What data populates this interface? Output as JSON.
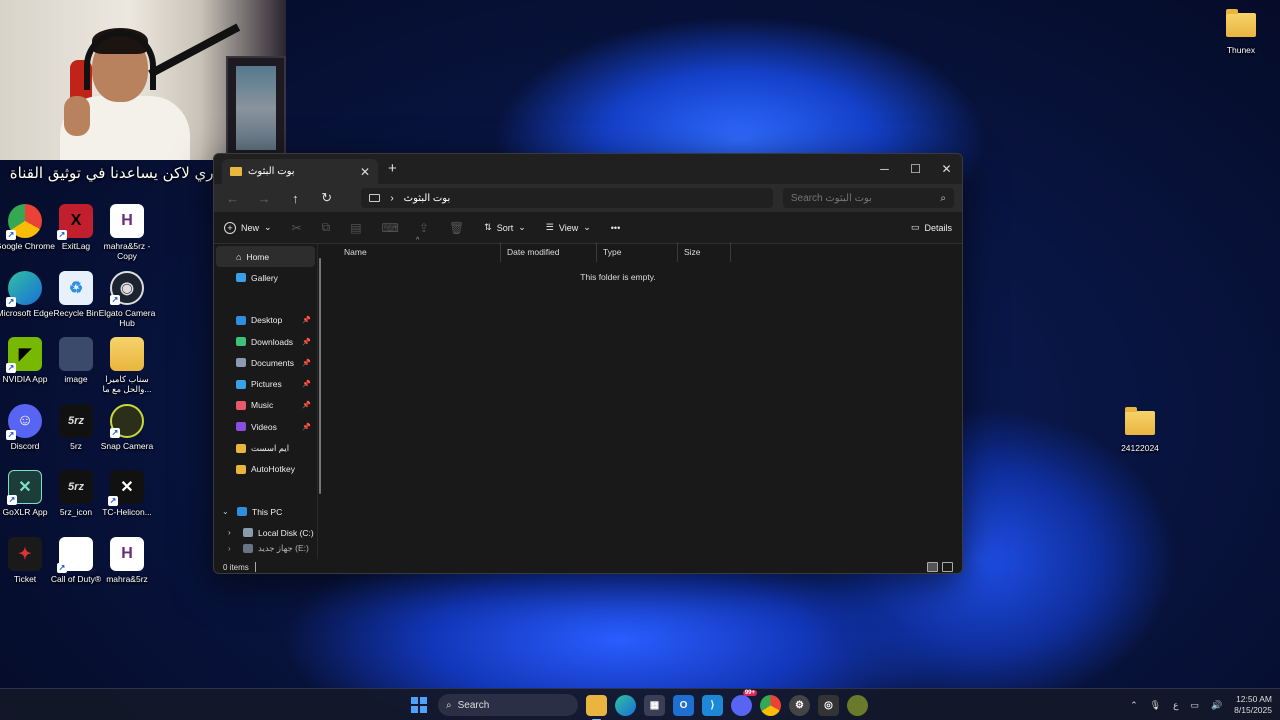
{
  "caption": "الاشتراك مو اجباري لاكن يساعدنا في توثيق القناة",
  "desktop_icons_left": [
    {
      "label": "Google Chrome",
      "icon": "chrome-icon"
    },
    {
      "label": "ExitLag",
      "icon": "exitlag-icon"
    },
    {
      "label": "mahra&5rz - Copy",
      "icon": "document-h-icon"
    },
    {
      "label": "Microsoft Edge",
      "icon": "edge-icon"
    },
    {
      "label": "Recycle Bin",
      "icon": "recycle-bin-icon"
    },
    {
      "label": "Elgato Camera Hub",
      "icon": "camera-hub-icon"
    },
    {
      "label": "NVIDIA App",
      "icon": "nvidia-icon"
    },
    {
      "label": "image",
      "icon": "image-file-icon"
    },
    {
      "label": "سناب كاميرا والحل مع ما...",
      "icon": "folder-icon"
    },
    {
      "label": "Discord",
      "icon": "discord-icon"
    },
    {
      "label": "5rz",
      "icon": "5rz-icon"
    },
    {
      "label": "Snap Camera",
      "icon": "snap-camera-icon"
    },
    {
      "label": "GoXLR App",
      "icon": "goxlr-icon"
    },
    {
      "label": "5rz_icon",
      "icon": "5rz-icon"
    },
    {
      "label": "TC-Helicon...",
      "icon": "tc-helicon-icon"
    },
    {
      "label": "Ticket",
      "icon": "ticket-icon"
    },
    {
      "label": "Call of Duty®",
      "icon": "document-icon"
    },
    {
      "label": "mahra&5rz",
      "icon": "document-h-icon"
    }
  ],
  "desktop_icons_right": [
    {
      "label": "Thunex",
      "icon": "folder-icon"
    },
    {
      "label": "24122024",
      "icon": "folder-icon"
    }
  ],
  "explorer": {
    "tab_title": "بوت البثوث",
    "new_tab_symbol": "+",
    "breadcrumb_sep": "›",
    "breadcrumb": "بوت البثوث",
    "search_placeholder": "Search بوت البثوث",
    "toolbar": {
      "new": "New",
      "sort": "Sort",
      "view": "View",
      "more": "•••",
      "details": "Details"
    },
    "nav": {
      "home": "Home",
      "gallery": "Gallery",
      "pinned": [
        {
          "label": "Desktop",
          "color": "#2f8fdf"
        },
        {
          "label": "Downloads",
          "color": "#3cc27a"
        },
        {
          "label": "Documents",
          "color": "#8a9bb0"
        },
        {
          "label": "Pictures",
          "color": "#3aa0e8"
        },
        {
          "label": "Music",
          "color": "#e85a6b"
        },
        {
          "label": "Videos",
          "color": "#8a4fe0"
        }
      ],
      "folders": [
        "ايم اسست",
        "AutoHotkey"
      ],
      "this_pc": "This PC",
      "local_disk": "Local Disk (C:)",
      "partial_drive": "جهاز جديد (E:)"
    },
    "columns": [
      "Name",
      "Date modified",
      "Type",
      "Size"
    ],
    "empty_message": "This folder is empty.",
    "status": "0 items"
  },
  "taskbar": {
    "search_label": "Search",
    "tray_lang": "ع",
    "time": "12:50 AM",
    "date": "8/15/2025",
    "discord_badge": "99+"
  }
}
